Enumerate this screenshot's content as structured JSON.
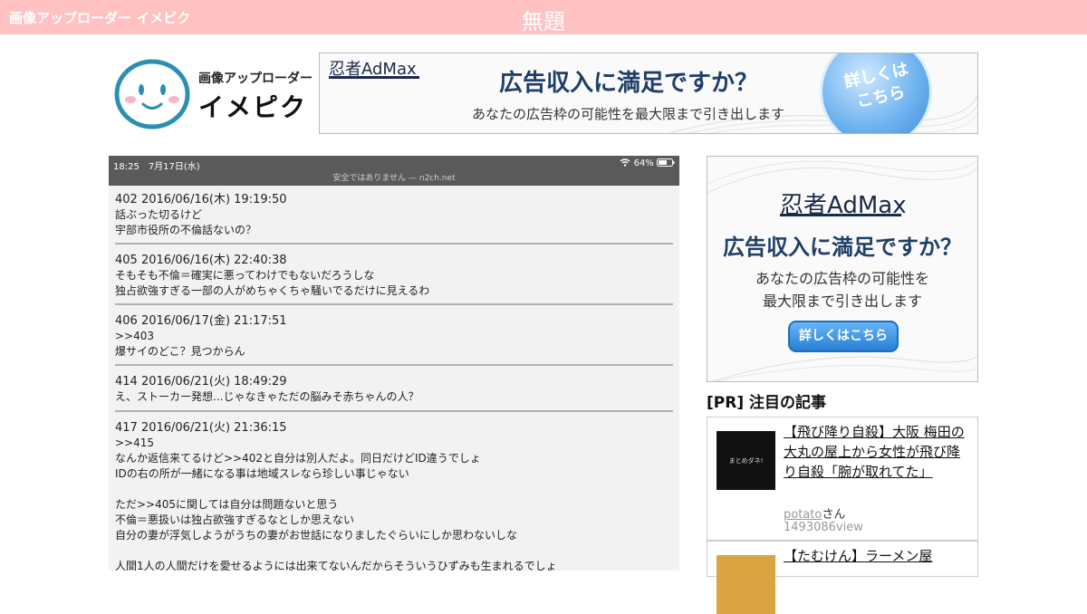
{
  "header": {
    "brand": "画像アップローダー イメピク",
    "title": "無題"
  },
  "logo": {
    "subtitle": "画像アップローダー",
    "name": "イメピク"
  },
  "ads": {
    "brand": "忍者AdMax",
    "headline": "広告収入に満足ですか？",
    "subline": "あなたの広告枠の可能性を最大限まで引き出します",
    "subline_side_1": "あなたの広告枠の可能性を",
    "subline_side_2": "最大限まで引き出します",
    "cta_circle_1": "詳しくは",
    "cta_circle_2": "こちら",
    "cta_button": "詳しくはこちら"
  },
  "screenshot": {
    "status_time": "18:25　7月17日(水)",
    "status_battery": "64%",
    "url_bar": "安全ではありません — n2ch.net",
    "posts": [
      {
        "head": "402 2016/06/16(木) 19:19:50",
        "lines": [
          "話ぶった切るけど",
          "宇部市役所の不倫話ないの？"
        ]
      },
      {
        "head": "405 2016/06/16(木) 22:40:38",
        "lines": [
          "そもそも不倫＝確実に悪ってわけでもないだろうしな",
          "独占欲強すぎる一部の人がめちゃくちゃ騒いでるだけに見えるわ"
        ]
      },
      {
        "head": "406 2016/06/17(金) 21:17:51",
        "lines": [
          ">>403",
          "爆サイのどこ？見つからん"
        ]
      },
      {
        "head": "414 2016/06/21(火) 18:49:29",
        "lines": [
          "え、ストーカー発想...じゃなきゃただの脳みそ赤ちゃんの人？"
        ]
      },
      {
        "head": "417 2016/06/21(火) 21:36:15",
        "lines": [
          ">>415",
          "なんか返信来てるけど>>402と自分は別人だよ。同日だけどID違うでしょ",
          "IDの右の所が一緒になる事は地域スレなら珍しい事じゃない",
          "",
          "ただ>>405に関しては自分は問題ないと思う",
          "不倫＝悪扱いは独占欲強すぎるなとしか思えない",
          "自分の妻が浮気しようがうちの妻がお世話になりましたぐらいにしか思わないしな",
          "",
          "人間1人の人間だけを愛せるようには出来てないんだからそういうひずみも生まれるでしょ"
        ]
      }
    ]
  },
  "pr": {
    "heading": "[PR] 注目の記事",
    "items": [
      {
        "thumb_text": "まとめダネ!",
        "title": "【飛び降り自殺】大阪 梅田の大丸の屋上から女性が飛び降り自殺「腕が取れてた」",
        "author": "potato",
        "author_suffix": "さん",
        "views": "1493086view"
      },
      {
        "title": "【たむけん】ラーメン屋"
      }
    ]
  },
  "colors": {
    "topbar": "#ffc1c1",
    "ad_navy": "#1a2a4a",
    "ad_blue": "#2a7fd4"
  }
}
